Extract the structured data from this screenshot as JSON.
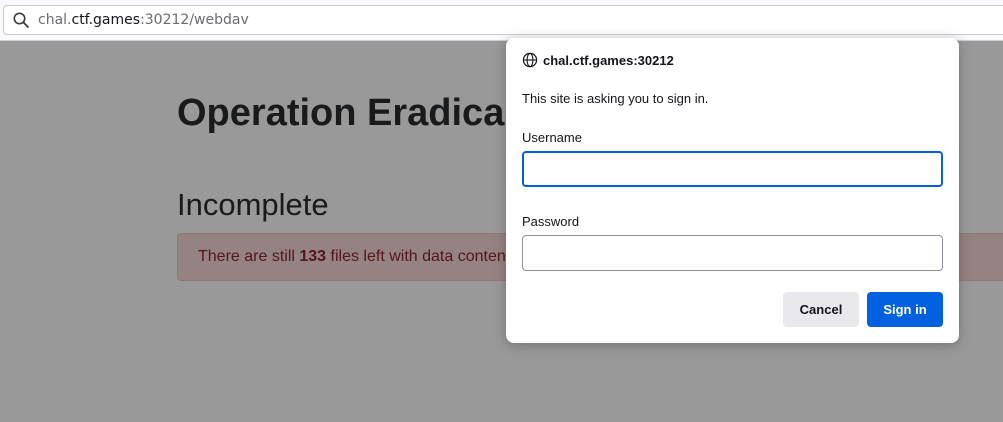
{
  "urlbar": {
    "url_prefix": "chal.",
    "url_host": "ctf.games",
    "url_suffix": ":30212/webdav",
    "icon": "search-icon"
  },
  "page": {
    "title": "Operation Eradica",
    "status_heading": "Incomplete",
    "alert_before": "There are still ",
    "alert_count": "133",
    "alert_after": " files left with data conten"
  },
  "dialog": {
    "origin": "chal.ctf.games:30212",
    "message": "This site is asking you to sign in.",
    "username_label": "Username",
    "username_value": "",
    "password_label": "Password",
    "password_value": "",
    "cancel_label": "Cancel",
    "signin_label": "Sign in",
    "icon": "globe-icon"
  },
  "colors": {
    "accent": "#0061e0",
    "alert_bg": "#f8d7da",
    "alert_text": "#842029",
    "overlay": "rgba(12,12,13,0.42)"
  }
}
